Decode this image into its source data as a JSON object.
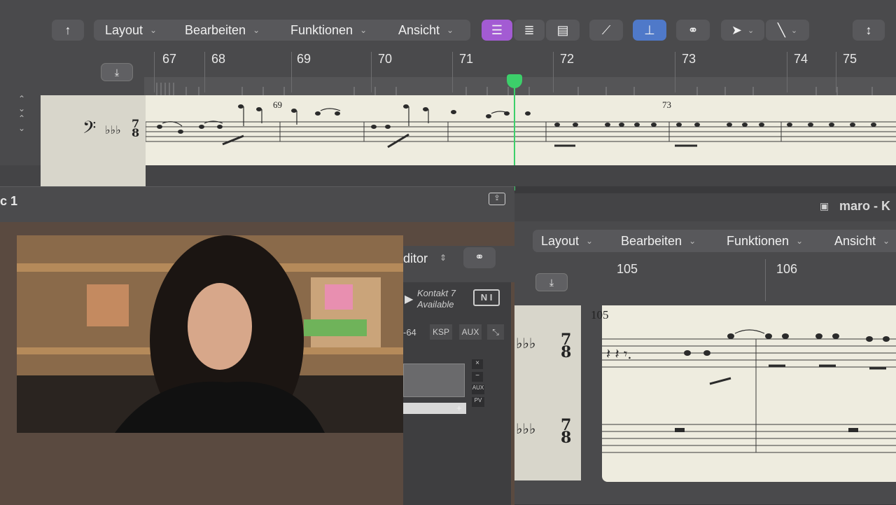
{
  "window_title_partial": "maro - K",
  "toolbar": {
    "menus": [
      "Layout",
      "Bearbeiten",
      "Funktionen",
      "Ansicht"
    ]
  },
  "ruler": {
    "bars": [
      "67",
      "68",
      "69",
      "70",
      "71",
      "72",
      "73",
      "74",
      "75"
    ]
  },
  "score_top": {
    "measure_marks": [
      "69",
      "73"
    ]
  },
  "left_window": {
    "title_partial": "c 1",
    "editor_label_partial": "ditor",
    "kontakt_line1": "Kontakt 7",
    "kontakt_line2": "Available",
    "ni_logo_text": "N I",
    "value_partial": "-64",
    "ksp_label": "KSP",
    "aux_label": "AUX",
    "side_aux": "AUX",
    "side_pv": "PV"
  },
  "right_window": {
    "menus": [
      "Layout",
      "Bearbeiten",
      "Funktionen",
      "Ansicht"
    ],
    "bars": [
      "105",
      "106"
    ],
    "measure_mark": "105",
    "time_signature_top": "7",
    "time_signature_bottom": "8"
  },
  "colors": {
    "accent_purple": "#a35bd3",
    "accent_blue": "#4f79c9",
    "playhead_green": "#3ccf6a",
    "score_paper": "#eeecdf"
  }
}
